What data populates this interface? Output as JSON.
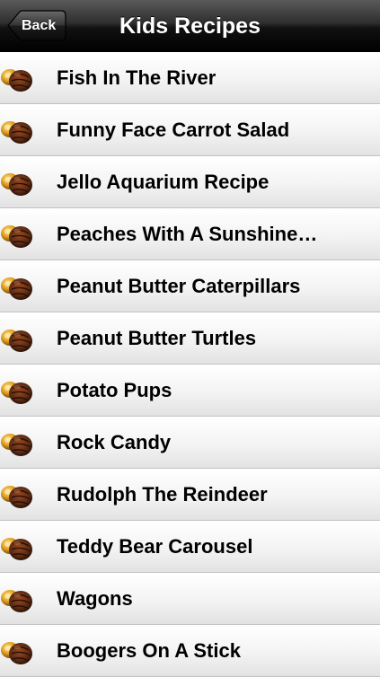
{
  "navbar": {
    "back_label": "Back",
    "title": "Kids Recipes"
  },
  "recipes": [
    {
      "label": "Fish In The River",
      "icon": "chocolate-candy-icon"
    },
    {
      "label": "Funny Face Carrot Salad",
      "icon": "chocolate-candy-icon"
    },
    {
      "label": "Jello Aquarium Recipe",
      "icon": "chocolate-candy-icon"
    },
    {
      "label": "Peaches With A Sunshine…",
      "icon": "chocolate-candy-icon"
    },
    {
      "label": "Peanut Butter Caterpillars",
      "icon": "chocolate-candy-icon"
    },
    {
      "label": "Peanut Butter Turtles",
      "icon": "chocolate-candy-icon"
    },
    {
      "label": "Potato Pups",
      "icon": "chocolate-candy-icon"
    },
    {
      "label": "Rock Candy",
      "icon": "chocolate-candy-icon"
    },
    {
      "label": "Rudolph The Reindeer",
      "icon": "chocolate-candy-icon"
    },
    {
      "label": "Teddy Bear Carousel",
      "icon": "chocolate-candy-icon"
    },
    {
      "label": "Wagons",
      "icon": "chocolate-candy-icon"
    },
    {
      "label": "Boogers On A Stick",
      "icon": "chocolate-candy-icon"
    }
  ],
  "colors": {
    "navbar_dark": "#000000",
    "navbar_light": "#5a5a5a",
    "row_top": "#ffffff",
    "row_bottom": "#e2e2e2",
    "separator": "#c2c2c2",
    "candy_gold": "#e0a020",
    "candy_brown": "#5a2a12"
  }
}
